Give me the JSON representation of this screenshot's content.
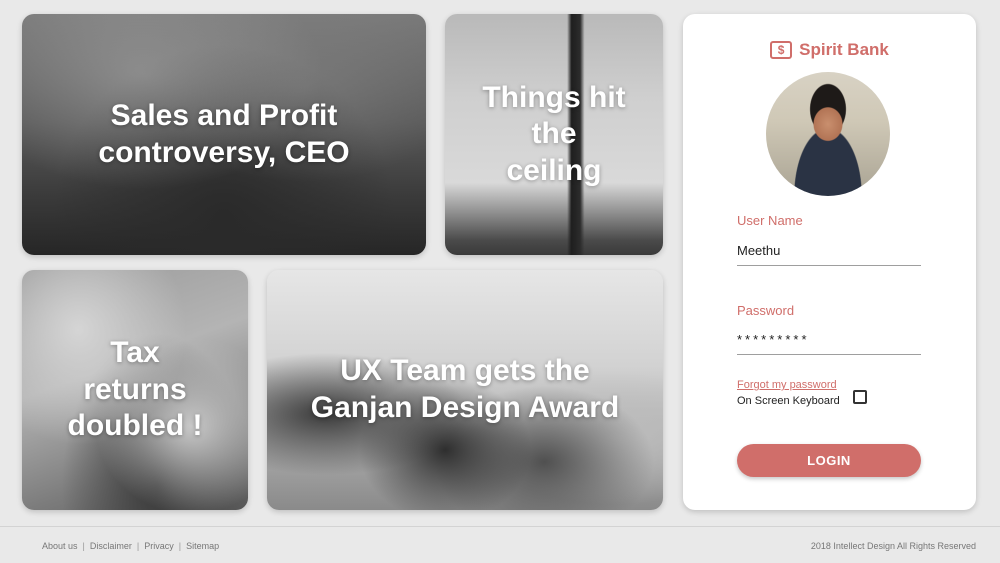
{
  "tiles": [
    {
      "caption": "Sales and Profit\ncontroversy, CEO"
    },
    {
      "caption": "Things hit\nthe\nceiling"
    },
    {
      "caption": "Tax\nreturns\ndoubled !"
    },
    {
      "caption": "UX Team gets the\nGanjan Design Award"
    }
  ],
  "login": {
    "brand_name": "Spirit Bank",
    "brand_icon": "$",
    "username_label": "User Name",
    "username_value": "Meethu",
    "password_label": "Password",
    "password_value": "*********",
    "forgot_password": "Forgot my password",
    "on_screen_keyboard": "On Screen Keyboard",
    "on_screen_keyboard_checked": false,
    "login_button": "LOGIN"
  },
  "footer": {
    "links": [
      "About us",
      "Disclaimer",
      "Privacy",
      "Sitemap"
    ],
    "separator": "|",
    "copyright": "2018 Intellect Design All Rights Reserved"
  },
  "colors": {
    "accent": "#d06e6a",
    "page_background": "#e9e9e9",
    "card_background": "#ffffff"
  },
  "icons": {
    "brand": "dollar-bill-icon",
    "avatar": "user-avatar-photo"
  }
}
